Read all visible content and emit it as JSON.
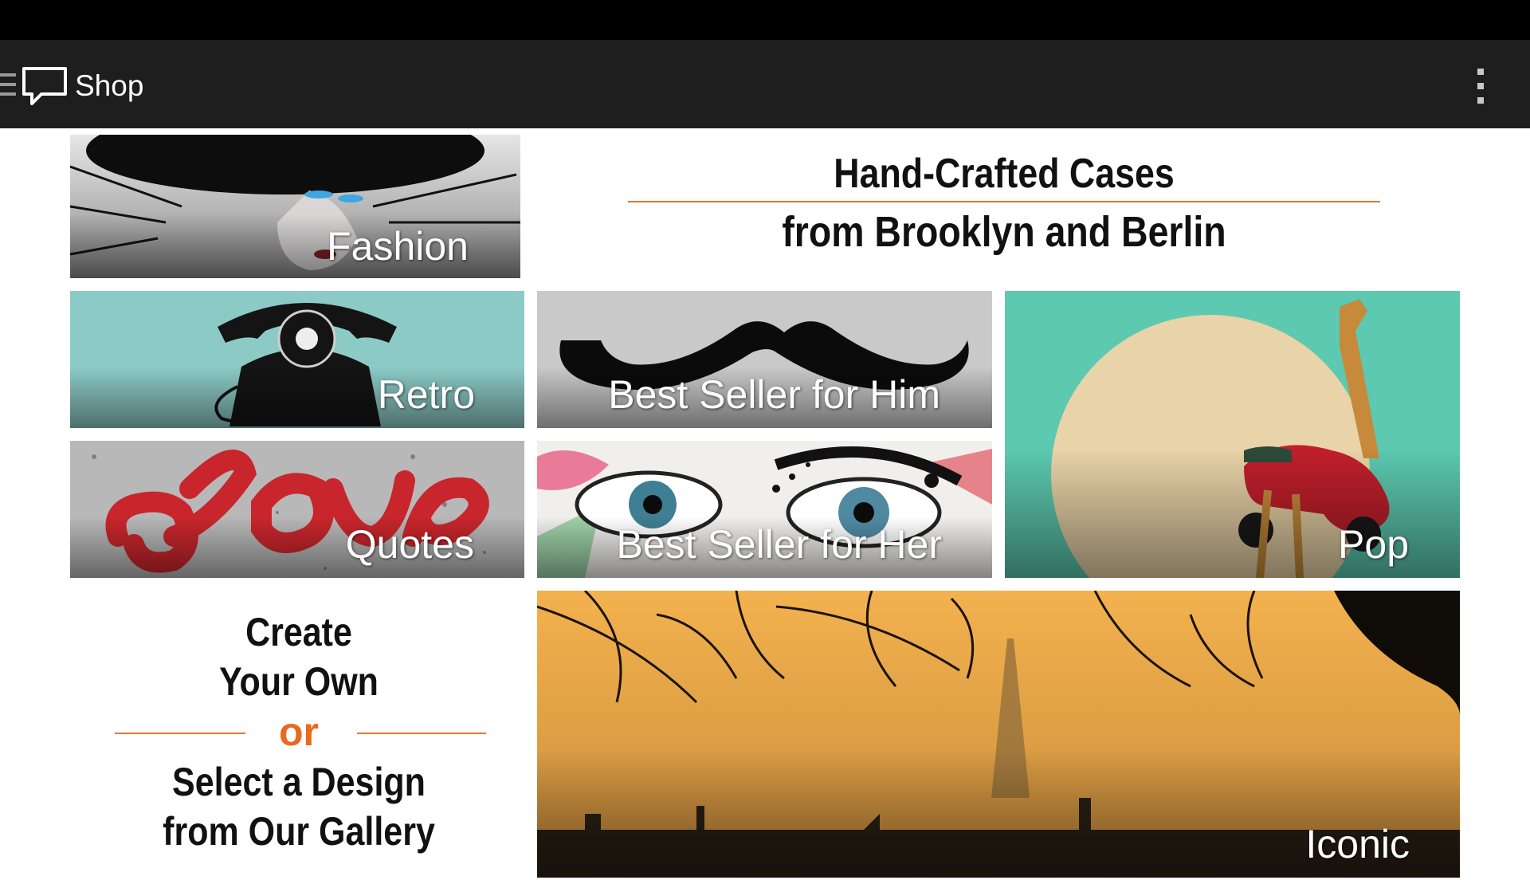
{
  "app_bar": {
    "title": "Shop"
  },
  "headline": {
    "line1": "Hand-Crafted Cases",
    "line2": "from Brooklyn and Berlin"
  },
  "promo": {
    "line1": "Create",
    "line2": "Your Own",
    "or": "or",
    "line3": "Select a Design",
    "line4": "from Our Gallery"
  },
  "categories": {
    "fashion": "Fashion",
    "retro": "Retro",
    "him": "Best Seller for Him",
    "pop": "Pop",
    "quotes": "Quotes",
    "her": "Best Seller for Her",
    "iconic": "Iconic"
  },
  "colors": {
    "accent": "#e8762d",
    "app_bar": "#1e1e1e",
    "status_bar": "#000000"
  }
}
